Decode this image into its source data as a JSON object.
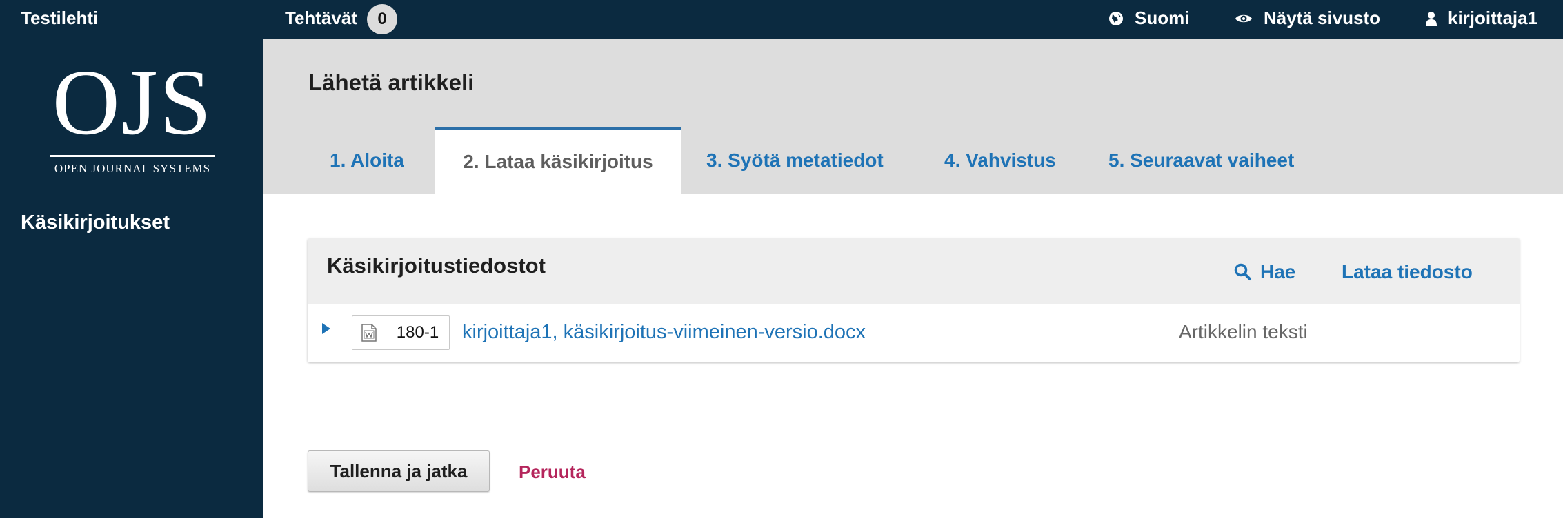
{
  "topbar": {
    "site_name": "Testilehti",
    "tasks_label": "Tehtävät",
    "tasks_count": "0",
    "language": "Suomi",
    "view_site": "Näytä sivusto",
    "username": "kirjoittaja1"
  },
  "sidebar": {
    "logo_text": "OJS",
    "logo_subtext": "OPEN JOURNAL SYSTEMS",
    "items": [
      {
        "label": "Käsikirjoitukset"
      }
    ]
  },
  "page": {
    "title": "Lähetä artikkeli",
    "tabs": [
      {
        "label": "1. Aloita"
      },
      {
        "label": "2. Lataa käsikirjoitus",
        "active": true
      },
      {
        "label": "3. Syötä metatiedot"
      },
      {
        "label": "4. Vahvistus"
      },
      {
        "label": "5. Seuraavat vaiheet"
      }
    ]
  },
  "files_panel": {
    "title": "Käsikirjoitustiedostot",
    "search_label": "Hae",
    "upload_label": "Lataa tiedosto",
    "rows": [
      {
        "id": "180-1",
        "file_name": "kirjoittaja1, käsikirjoitus-viimeinen-versio.docx",
        "file_type": "Artikkelin teksti",
        "icon": "word-document-icon"
      }
    ]
  },
  "actions": {
    "save_label": "Tallenna ja jatka",
    "cancel_label": "Peruuta"
  },
  "colors": {
    "nav_bg": "#0b2a40",
    "link": "#1e73b6",
    "cancel": "#b5265c",
    "header_bg": "#dddddd"
  }
}
